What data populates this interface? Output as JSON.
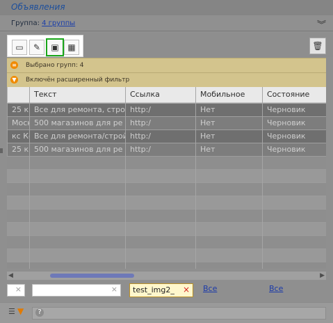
{
  "app": {
    "title": "Объявления"
  },
  "group_bar": {
    "label": "Группа:",
    "link": "4 группы",
    "collapse_icon": "double-chevron-down-icon"
  },
  "toolbar": {
    "buttons": [
      {
        "icon": "document-icon",
        "selected": false
      },
      {
        "icon": "edit-icon",
        "selected": false
      },
      {
        "icon": "image-icon",
        "selected": true
      },
      {
        "icon": "table-icon",
        "selected": false
      }
    ],
    "delete_icon": "trash-icon"
  },
  "info": {
    "groups_selected": "Выбрано групп: 4",
    "filter_enabled": "Включён расширенный фильтр"
  },
  "grid": {
    "columns": [
      "Текст",
      "Ссылка",
      "Мобильное",
      "Состояние"
    ],
    "rows": [
      {
        "lead": "25 к",
        "text": "Все для ремонта, строй",
        "link": "http:/",
        "mobile": "Нет",
        "state": "Черновик"
      },
      {
        "lead": "Моск",
        "text": "500 магазинов для ре",
        "link": "http:/",
        "mobile": "Нет",
        "state": "Черновик"
      },
      {
        "lead": "кс Кс",
        "text": "Все для ремонта/строй",
        "link": "http:/",
        "mobile": "Нет",
        "state": "Черновик"
      },
      {
        "lead": "25 к",
        "text": "500 магазинов для ре",
        "link": "http:/",
        "mobile": "Нет",
        "state": "Черновик"
      }
    ]
  },
  "filters": {
    "tag_value": "test_img2_",
    "link_all_1": "Все",
    "link_all_2": "Все"
  },
  "bottom": {
    "help_glyph": "?"
  },
  "colors": {
    "accent_green": "#1aa61a",
    "info_bg": "#d3c48d",
    "link_blue": "#1b3aa9"
  }
}
